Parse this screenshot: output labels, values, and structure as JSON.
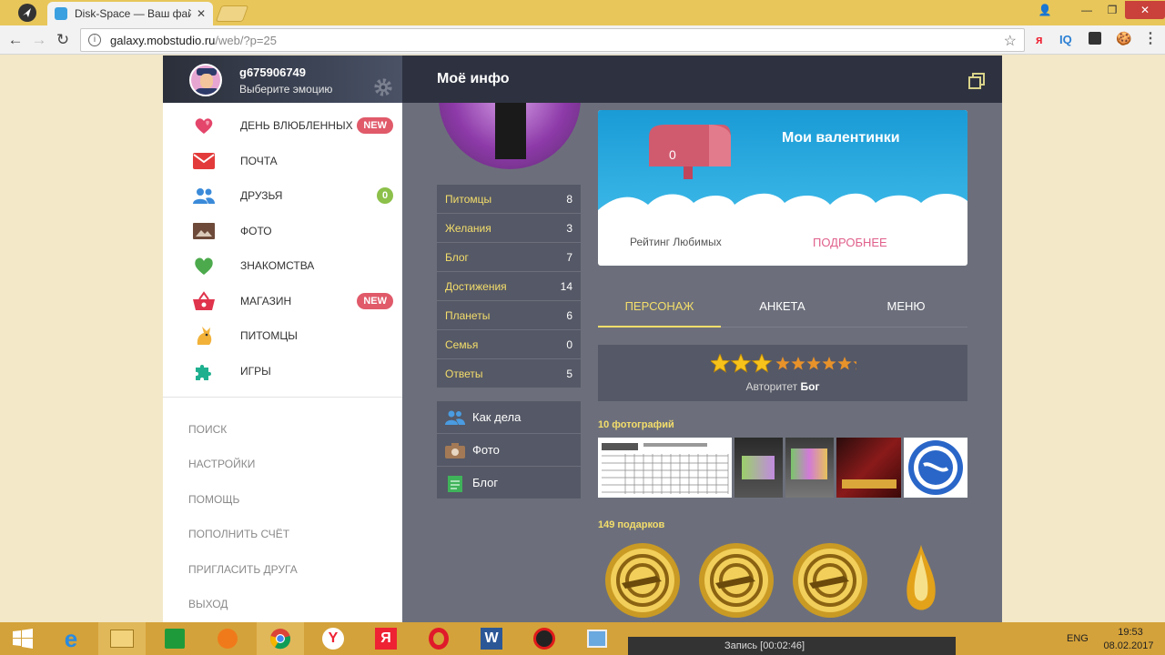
{
  "browser": {
    "tab_title": "Disk-Space — Ваш файл",
    "url_host": "galaxy.mobstudio.ru",
    "url_path": "/web/?p=25",
    "ext_ya": "я",
    "ext_iq": "IQ"
  },
  "profile": {
    "name": "g675906749",
    "emotion": "Выберите эмоцию"
  },
  "sidebar": {
    "items": [
      {
        "label": "День влюбленных",
        "badge": "NEW"
      },
      {
        "label": "Почта"
      },
      {
        "label": "Друзья",
        "count": "0"
      },
      {
        "label": "Фото"
      },
      {
        "label": "Знакомства"
      },
      {
        "label": "Магазин",
        "badge": "NEW"
      },
      {
        "label": "Питомцы"
      },
      {
        "label": "Игры"
      }
    ],
    "lower": [
      "Поиск",
      "Настройки",
      "Помощь",
      "Пополнить счёт",
      "Пригласить друга",
      "Выход"
    ]
  },
  "main": {
    "title": "Моё инфо",
    "stats": [
      {
        "label": "Питомцы",
        "value": "8"
      },
      {
        "label": "Желания",
        "value": "3"
      },
      {
        "label": "Блог",
        "value": "7"
      },
      {
        "label": "Достижения",
        "value": "14"
      },
      {
        "label": "Планеты",
        "value": "6"
      },
      {
        "label": "Семья",
        "value": "0"
      },
      {
        "label": "Ответы",
        "value": "5"
      }
    ],
    "actions": [
      {
        "label": "Как дела"
      },
      {
        "label": "Фото"
      },
      {
        "label": "Блог"
      }
    ],
    "valentines": {
      "title": "Мои валентинки",
      "count": "0",
      "rating": "Рейтинг Любимых",
      "more": "ПОДРОБНЕЕ"
    },
    "tabs": [
      "ПЕРСОНАЖ",
      "АНКЕТА",
      "МЕНЮ"
    ],
    "rating": {
      "stars_filled": 3,
      "stars_total": 10,
      "authority_label": "Авторитет",
      "authority_value": "Бог"
    },
    "photos_label": "10 фотографий",
    "gifts_label": "149 подарков"
  },
  "taskbar": {
    "record": "Запись [00:02:46]",
    "lang": "ENG",
    "time": "19:53",
    "date": "08.02.2017"
  },
  "colors": {
    "titlebar": "#e8c65a",
    "sidebar_header": "#2e3240",
    "main_bg": "#6c6f7b",
    "accent_yellow": "#f4de6b",
    "badge_new": "#e05a6a",
    "badge_count": "#8cc04a",
    "sky": "#1a9bd6",
    "link_pink": "#e0608c",
    "taskbar": "#d4a23a"
  }
}
